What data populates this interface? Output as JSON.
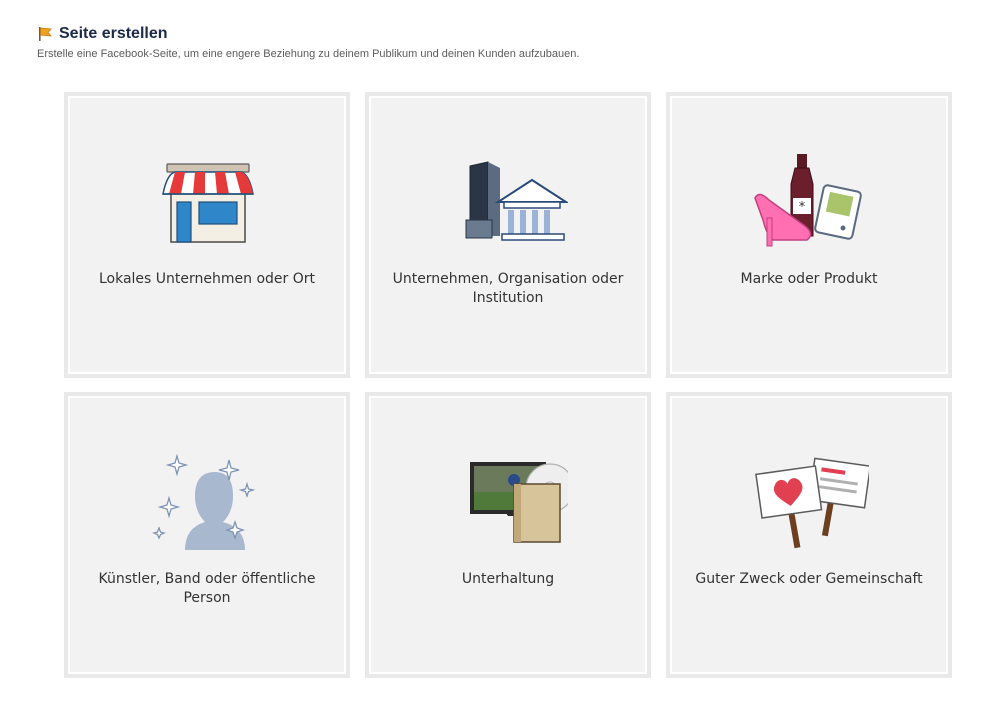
{
  "header": {
    "title": "Seite erstellen",
    "subtitle": "Erstelle eine Facebook-Seite, um eine engere Beziehung zu deinem Publikum und deinen Kunden aufzubauen."
  },
  "categories": [
    {
      "label": "Lokales Unternehmen oder Ort",
      "icon": "storefront-icon"
    },
    {
      "label": "Unternehmen, Organisation oder Institution",
      "icon": "office-buildings-icon"
    },
    {
      "label": "Marke oder Produkt",
      "icon": "products-icon"
    },
    {
      "label": "Künstler, Band oder öffentliche Person",
      "icon": "person-silhouette-icon"
    },
    {
      "label": "Unterhaltung",
      "icon": "entertainment-icon"
    },
    {
      "label": "Guter Zweck oder Gemeinschaft",
      "icon": "protest-signs-icon"
    }
  ],
  "colors": {
    "title": "#1c2a47",
    "tile_background": "#f2f2f2",
    "tile_frame": "#e9e9e9"
  }
}
